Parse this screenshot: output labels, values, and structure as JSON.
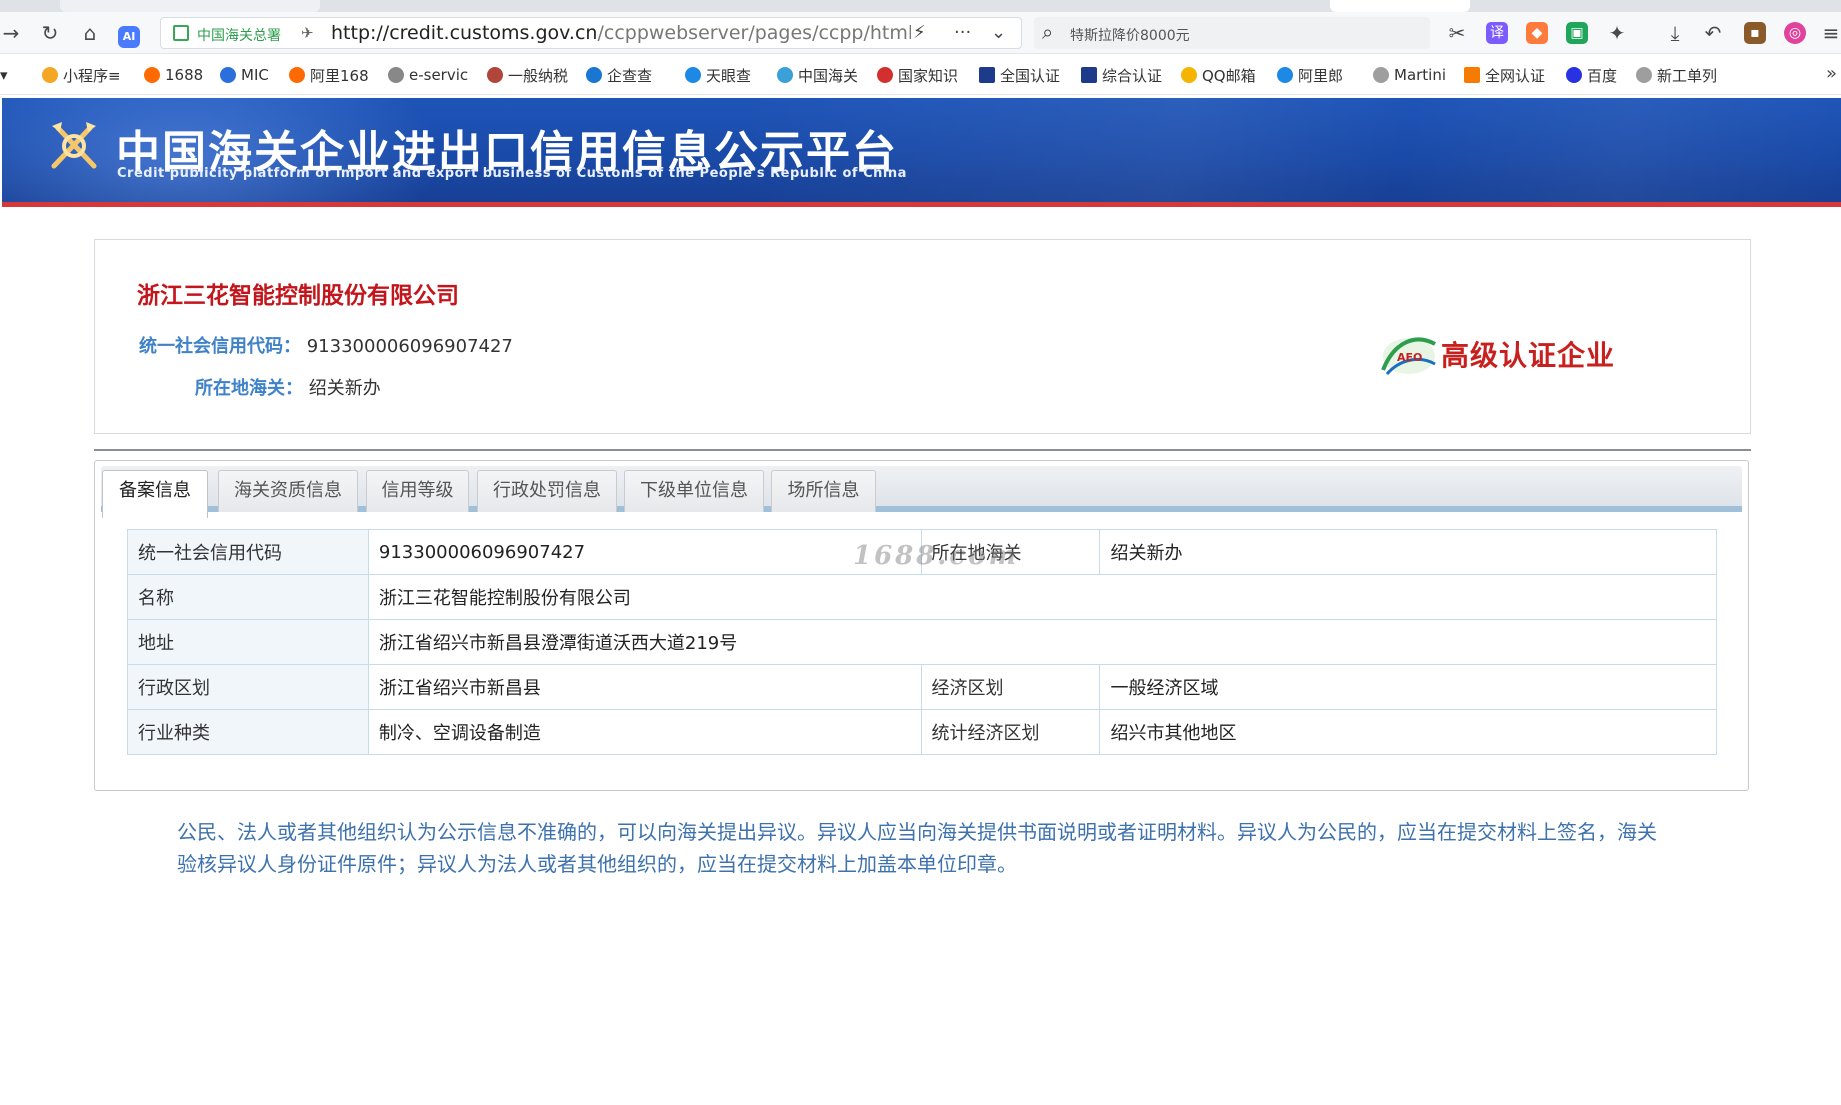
{
  "browser": {
    "site_name": "中国海关总署",
    "url_host": "http://credit.customs.gov.cn",
    "url_path": "/ccppwebserver/pages/ccpp/html/detai",
    "search_text": "特斯拉降价8000元"
  },
  "bookmarks": [
    {
      "label": "小程序≡",
      "color": "#f5a623"
    },
    {
      "label": "1688",
      "color": "#ff6a00"
    },
    {
      "label": "MIC",
      "color": "#2a6fdb"
    },
    {
      "label": "阿里168",
      "color": "#ff6a00"
    },
    {
      "label": "e-servic",
      "color": "#888888"
    },
    {
      "label": "一般纳税",
      "color": "#b0463a"
    },
    {
      "label": "企查查",
      "color": "#1976d2"
    },
    {
      "label": "天眼查",
      "color": "#1e88e5"
    },
    {
      "label": "中国海关",
      "color": "#3aa0d8"
    },
    {
      "label": "国家知识",
      "color": "#d32f2f"
    },
    {
      "label": "全国认证",
      "color": "#1e3a8a"
    },
    {
      "label": "综合认证",
      "color": "#1e3a8a"
    },
    {
      "label": "QQ邮箱",
      "color": "#f4b400"
    },
    {
      "label": "阿里郎",
      "color": "#1e88e5"
    },
    {
      "label": "Martini",
      "color": "#9e9e9e"
    },
    {
      "label": "全网认证",
      "color": "#f57c00"
    },
    {
      "label": "百度",
      "color": "#2932e1"
    },
    {
      "label": "新工单列",
      "color": "#9e9e9e"
    }
  ],
  "header": {
    "title": "中国海关企业进出口信用信息公示平台",
    "subtitle": "Credit publicity platform of import and export business of Customs of the People's Republic of China"
  },
  "company": {
    "name": "浙江三花智能控制股份有限公司",
    "credit_code_label": "统一社会信用代码：",
    "credit_code": "913300006096907427",
    "customs_label": "所在地海关：",
    "customs": "绍关新办",
    "aeo_badge": "高级认证企业",
    "aeo_text": "AEO"
  },
  "tabs": [
    {
      "label": "备案信息",
      "active": true
    },
    {
      "label": "海关资质信息",
      "active": false
    },
    {
      "label": "信用等级",
      "active": false
    },
    {
      "label": "行政处罚信息",
      "active": false
    },
    {
      "label": "下级单位信息",
      "active": false
    },
    {
      "label": "场所信息",
      "active": false
    }
  ],
  "record": {
    "credit_code_label": "统一社会信用代码",
    "credit_code": "913300006096907427",
    "customs_label": "所在地海关",
    "customs": "绍关新办",
    "name_label": "名称",
    "name": "浙江三花智能控制股份有限公司",
    "address_label": "地址",
    "address": "浙江省绍兴市新昌县澄潭街道沃西大道219号",
    "admin_region_label": "行政区划",
    "admin_region": "浙江省绍兴市新昌县",
    "econ_region_label": "经济区划",
    "econ_region": "一般经济区域",
    "industry_label": "行业种类",
    "industry": "制冷、空调设备制造",
    "stat_region_label": "统计经济区划",
    "stat_region": "绍兴市其他地区"
  },
  "watermark": "1688.com",
  "notice": "公民、法人或者其他组织认为公示信息不准确的，可以向海关提出异议。异议人应当向海关提供书面说明或者证明材料。异议人为公民的，应当在提交材料上签名，海关验核异议人身份证件原件；异议人为法人或者其他组织的，应当在提交材料上加盖本单位印章。"
}
